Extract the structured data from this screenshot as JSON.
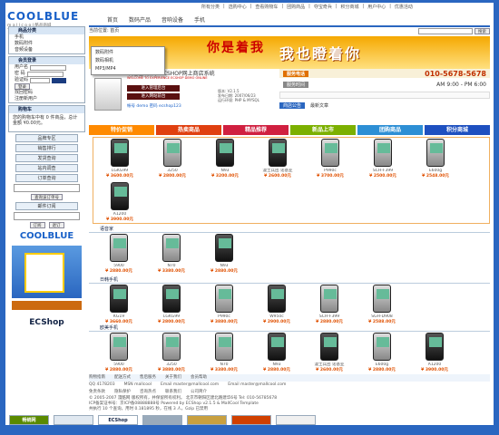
{
  "toplinks": [
    "所有分类",
    "选购中心",
    "查看购物车",
    "团购商品",
    "夺宝奇兵",
    "积分商城",
    "用户中心",
    "优惠活动"
  ],
  "logo": {
    "title": "COOLBLUE",
    "sub": "m a l l c o o l 酷品商城",
    "tag": "Template For ECShop"
  },
  "nav": [
    "首页",
    "数码产品",
    "音响设备",
    "手机"
  ],
  "sidebar": {
    "cat_title": "商品分类",
    "cats": [
      "手机",
      "数码附件",
      "音频设备"
    ],
    "member_title": "会员登录",
    "login_labels": [
      "用户名",
      "密 码",
      "验证码"
    ],
    "login_btn": "登录",
    "links": [
      "找回密码",
      "注册新用户"
    ],
    "cart_title": "购物车",
    "cart_text": "您的购物车中有 0 件商品，总计金额 ¥0.00元。",
    "menu": [
      "品牌专区",
      "销售排行",
      "发货查询",
      "站内调查",
      "订单查询"
    ],
    "order_btn": "查询该订单号",
    "email_title": "邮件订阅",
    "email_btns": [
      "订阅",
      "退订"
    ],
    "ad_brand": "COOLBLUE"
  },
  "dropdown": [
    "数码附件",
    "数码相机",
    "MP3/MP4"
  ],
  "breadcrumb": "当前位置: 首页",
  "search": {
    "placeholder": "",
    "btn": "搜索"
  },
  "banner": {
    "slogan1": "你是着我",
    "slogan2": "我也瞪着你",
    "welcome": "欢迎在线体验ECSHOP网上商店系统",
    "welcome_sub": "WELCOME TO EXPERIENCE ECSHOP DEMO ONLINE",
    "admin_btn": "进入管理后台",
    "front_btn": "进入网站前台",
    "account": "帐号 demo  密码 ecshop123",
    "version": "版本: V2.1.5",
    "release": "发布日期: 2007/06/23",
    "env": "运行环境: PHP & MYSQL",
    "phone_label": "服务电话",
    "phone": "010-5678-5678",
    "hours_label": "服务时间",
    "hours": "AM 9:00 - PM 6:00",
    "tags": [
      "商店公告",
      "最新文章"
    ]
  },
  "section_tabs": [
    {
      "label": "特价促销",
      "color": "#ff8a00"
    },
    {
      "label": "热卖商品",
      "color": "#e04010"
    },
    {
      "label": "精品推荐",
      "color": "#d02040"
    },
    {
      "label": "新品上市",
      "color": "#7cb000"
    },
    {
      "label": "团购商品",
      "color": "#2d8fd5"
    },
    {
      "label": "积分商城",
      "color": "#1e50c0"
    }
  ],
  "hot": [
    {
      "name": "LGKG99",
      "price": "¥ 3600.00元",
      "s": 0
    },
    {
      "name": "3250",
      "price": "¥ 2800.00元",
      "s": 1
    },
    {
      "name": "N93",
      "price": "¥ 3200.00元",
      "s": 0
    },
    {
      "name": "漫士兵团 诺基亚",
      "price": "¥ 2600.00元",
      "s": 0
    },
    {
      "name": "P990c",
      "price": "¥ 3700.00元",
      "s": 1
    },
    {
      "name": "SCH-F399",
      "price": "¥ 2500.00元",
      "s": 1
    },
    {
      "name": "E600g",
      "price": "¥ 2548.00元",
      "s": 1
    },
    {
      "name": "A1200",
      "price": "¥ 3900.00元",
      "s": 0
    }
  ],
  "row2_title": "语音家",
  "row2": [
    {
      "name": "5900",
      "price": "¥ 2880.00元",
      "s": 1
    },
    {
      "name": "N70",
      "price": "¥ 3380.00元",
      "s": 1
    },
    {
      "name": "N93",
      "price": "¥ 2880.00元",
      "s": 0
    }
  ],
  "row3_title": "日韩手机",
  "row3": [
    {
      "name": "KG19",
      "price": "¥ 3660.00元",
      "s": 0
    },
    {
      "name": "LGKG99",
      "price": "¥ 2800.00元",
      "s": 0
    },
    {
      "name": "P990c",
      "price": "¥ 3880.00元",
      "s": 1
    },
    {
      "name": "W950c",
      "price": "¥ 2900.00元",
      "s": 0
    },
    {
      "name": "SCH-F399",
      "price": "¥ 2880.00元",
      "s": 1
    },
    {
      "name": "SGH-D908",
      "price": "¥ 2588.00元",
      "s": 1
    }
  ],
  "row4_title": "欧美手机",
  "row4": [
    {
      "name": "5900",
      "price": "¥ 2880.00元",
      "s": 1
    },
    {
      "name": "3250",
      "price": "¥ 3880.00元",
      "s": 1
    },
    {
      "name": "N70",
      "price": "¥ 3380.00元",
      "s": 1
    },
    {
      "name": "N93",
      "price": "¥ 2880.00元",
      "s": 0
    },
    {
      "name": "漫士兵团 诺基亚",
      "price": "¥ 2600.00元",
      "s": 0
    },
    {
      "name": "E600g",
      "price": "¥ 2880.00元",
      "s": 1
    },
    {
      "name": "A1200",
      "price": "¥ 3900.00元",
      "s": 0
    }
  ],
  "more": "MORE",
  "footer": {
    "links": [
      "购物指南",
      "配送方式",
      "售后服务",
      "关于我们",
      "会员帮助"
    ],
    "contact": [
      "QQ 4178203",
      "MSN mallcool",
      "Email master@mallcool.com",
      "Email master@mallcool.com"
    ],
    "nav": [
      "免责条款",
      "隐私保护",
      "咨询热点",
      "联系我们",
      "公司简介"
    ],
    "copy": "© 2005-2007 漫酷网 版权所有，并保留所有权利。 北京市朝阳区建北路建华6号  Tel: 010-56785678",
    "icp": "ICP备案证书号：京ICP备08888888号   Powered by ECShop v2.1.5 & MallCool Template",
    "stats": "共执行 10 个查询，用时 0.181895 秒，在线 3 人，Gzip 已禁用"
  },
  "partners": [
    "畅销网",
    "",
    "ECShop",
    "",
    "",
    "",
    ""
  ]
}
